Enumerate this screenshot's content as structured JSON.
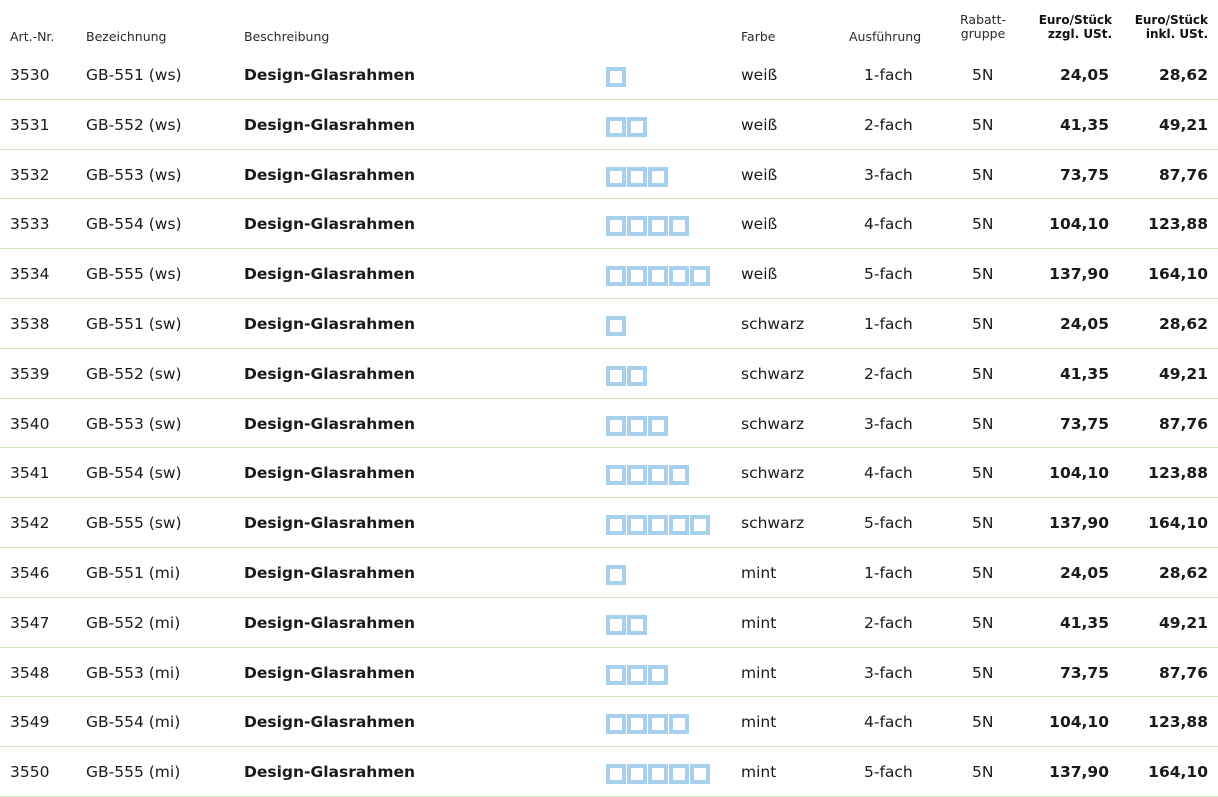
{
  "header": {
    "art": "Art.-Nr.",
    "bez": "Bezeichnung",
    "des": "Beschreibung",
    "far": "Farbe",
    "aus": "Ausführung",
    "rab1": "Rabatt-",
    "rab2": "gruppe",
    "ex1": "Euro/Stück",
    "ex2": "zzgl. USt.",
    "in1": "Euro/Stück",
    "in2": "inkl. USt."
  },
  "colors": {
    "frame_icon": "#a6d0ec",
    "row_divider": "#cfe6c2"
  },
  "rows": [
    {
      "art": "3530",
      "bez": "GB-551 (ws)",
      "des": "Design-Glasrahmen",
      "frames": 1,
      "icon": "glass-frame-1-icon",
      "far": "weiß",
      "aus": "1-fach",
      "rab": "5N",
      "ex": "24,05",
      "in": "28,62"
    },
    {
      "art": "3531",
      "bez": "GB-552 (ws)",
      "des": "Design-Glasrahmen",
      "frames": 2,
      "icon": "glass-frame-2-icon",
      "far": "weiß",
      "aus": "2-fach",
      "rab": "5N",
      "ex": "41,35",
      "in": "49,21"
    },
    {
      "art": "3532",
      "bez": "GB-553 (ws)",
      "des": "Design-Glasrahmen",
      "frames": 3,
      "icon": "glass-frame-3-icon",
      "far": "weiß",
      "aus": "3-fach",
      "rab": "5N",
      "ex": "73,75",
      "in": "87,76"
    },
    {
      "art": "3533",
      "bez": "GB-554 (ws)",
      "des": "Design-Glasrahmen",
      "frames": 4,
      "icon": "glass-frame-4-icon",
      "far": "weiß",
      "aus": "4-fach",
      "rab": "5N",
      "ex": "104,10",
      "in": "123,88"
    },
    {
      "art": "3534",
      "bez": "GB-555 (ws)",
      "des": "Design-Glasrahmen",
      "frames": 5,
      "icon": "glass-frame-5-icon",
      "far": "weiß",
      "aus": "5-fach",
      "rab": "5N",
      "ex": "137,90",
      "in": "164,10"
    },
    {
      "art": "3538",
      "bez": "GB-551 (sw)",
      "des": "Design-Glasrahmen",
      "frames": 1,
      "icon": "glass-frame-1-icon",
      "far": "schwarz",
      "aus": "1-fach",
      "rab": "5N",
      "ex": "24,05",
      "in": "28,62"
    },
    {
      "art": "3539",
      "bez": "GB-552 (sw)",
      "des": "Design-Glasrahmen",
      "frames": 2,
      "icon": "glass-frame-2-icon",
      "far": "schwarz",
      "aus": "2-fach",
      "rab": "5N",
      "ex": "41,35",
      "in": "49,21"
    },
    {
      "art": "3540",
      "bez": "GB-553 (sw)",
      "des": "Design-Glasrahmen",
      "frames": 3,
      "icon": "glass-frame-3-icon",
      "far": "schwarz",
      "aus": "3-fach",
      "rab": "5N",
      "ex": "73,75",
      "in": "87,76"
    },
    {
      "art": "3541",
      "bez": "GB-554 (sw)",
      "des": "Design-Glasrahmen",
      "frames": 4,
      "icon": "glass-frame-4-icon",
      "far": "schwarz",
      "aus": "4-fach",
      "rab": "5N",
      "ex": "104,10",
      "in": "123,88"
    },
    {
      "art": "3542",
      "bez": "GB-555 (sw)",
      "des": "Design-Glasrahmen",
      "frames": 5,
      "icon": "glass-frame-5-icon",
      "far": "schwarz",
      "aus": "5-fach",
      "rab": "5N",
      "ex": "137,90",
      "in": "164,10"
    },
    {
      "art": "3546",
      "bez": "GB-551 (mi)",
      "des": "Design-Glasrahmen",
      "frames": 1,
      "icon": "glass-frame-1-icon",
      "far": "mint",
      "aus": "1-fach",
      "rab": "5N",
      "ex": "24,05",
      "in": "28,62"
    },
    {
      "art": "3547",
      "bez": "GB-552 (mi)",
      "des": "Design-Glasrahmen",
      "frames": 2,
      "icon": "glass-frame-2-icon",
      "far": "mint",
      "aus": "2-fach",
      "rab": "5N",
      "ex": "41,35",
      "in": "49,21"
    },
    {
      "art": "3548",
      "bez": "GB-553 (mi)",
      "des": "Design-Glasrahmen",
      "frames": 3,
      "icon": "glass-frame-3-icon",
      "far": "mint",
      "aus": "3-fach",
      "rab": "5N",
      "ex": "73,75",
      "in": "87,76"
    },
    {
      "art": "3549",
      "bez": "GB-554 (mi)",
      "des": "Design-Glasrahmen",
      "frames": 4,
      "icon": "glass-frame-4-icon",
      "far": "mint",
      "aus": "4-fach",
      "rab": "5N",
      "ex": "104,10",
      "in": "123,88"
    },
    {
      "art": "3550",
      "bez": "GB-555 (mi)",
      "des": "Design-Glasrahmen",
      "frames": 5,
      "icon": "glass-frame-5-icon",
      "far": "mint",
      "aus": "5-fach",
      "rab": "5N",
      "ex": "137,90",
      "in": "164,10"
    }
  ]
}
